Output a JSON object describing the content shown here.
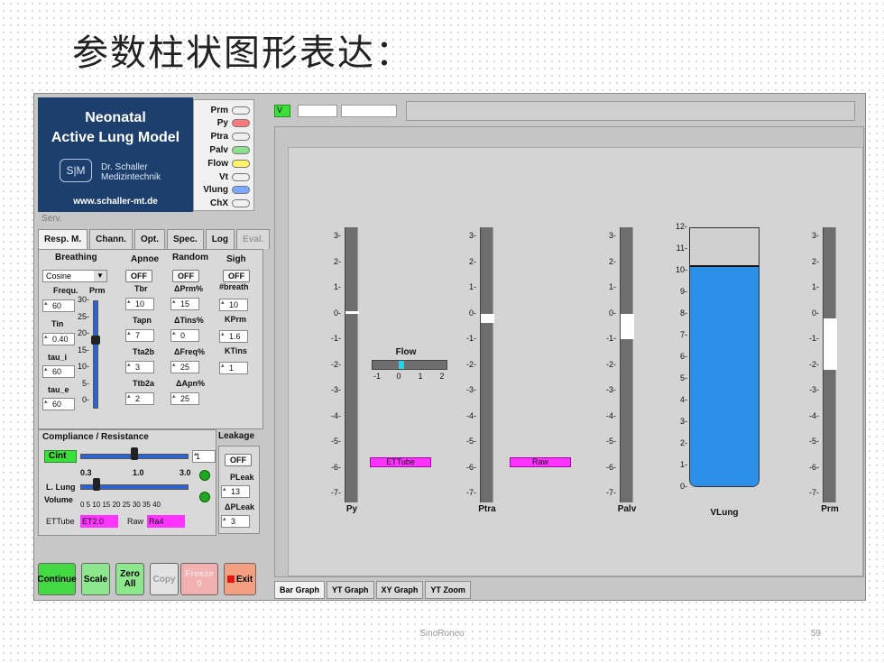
{
  "slide": {
    "title": "参数柱状图形表达：",
    "footer": "SinoRoneo",
    "page": "59"
  },
  "logo": {
    "title1": "Neonatal",
    "title2": "Active Lung Model",
    "emblem": "S|M",
    "company1": "Dr. Schaller",
    "company2": "Medizintechnik",
    "url": "www.schaller-mt.de"
  },
  "curves": [
    {
      "label": "Prm",
      "color": "#f0f0f0"
    },
    {
      "label": "Py",
      "color": "#ff7a7a"
    },
    {
      "label": "Ptra",
      "color": "#f0f0f0"
    },
    {
      "label": "Palv",
      "color": "#8de08d"
    },
    {
      "label": "Flow",
      "color": "#fff36a"
    },
    {
      "label": "Vt",
      "color": "#f0f0f0"
    },
    {
      "label": "Vlung",
      "color": "#7aa9ff"
    },
    {
      "label": "ChX",
      "color": "#f0f0f0"
    }
  ],
  "serv_label": "Serv.",
  "tabs": [
    "Resp. M.",
    "Chann.",
    "Opt.",
    "Spec.",
    "Log",
    "Eval."
  ],
  "breathing": {
    "headers": [
      "Breathing",
      "Apnoe",
      "Random",
      "Sigh"
    ],
    "waveform": "Cosine",
    "frequ_label": "Frequ.",
    "prm_label": "Prm",
    "frequ_value": "60",
    "tin_label": "Tin",
    "tin_value": "0.40",
    "taui_label": "tau_i",
    "taui_value": "60",
    "taue_label": "tau_e",
    "taue_value": "60",
    "prm_ticks": [
      "30-",
      "25-",
      "20-",
      "15-",
      "10-",
      "5-",
      "0-"
    ],
    "prm_value": 19,
    "apnoe_off": "OFF",
    "tbr_label": "Tbr",
    "tbr_value": "10",
    "tapn_label": "Tapn",
    "tapn_value": "7",
    "tta2b_label": "Tta2b",
    "tta2b_value": "3",
    "ttb2a_label": "Ttb2a",
    "ttb2a_value": "2",
    "random_off": "OFF",
    "dprm_label": "ΔPrm%",
    "dprm_value": "15",
    "dtins_label": "ΔTins%",
    "dtins_value": "0",
    "dfreq_label": "ΔFreq%",
    "dfreq_value": "25",
    "dapn_label": "ΔApn%",
    "dapn_value": "25",
    "sigh_off": "OFF",
    "nbreath_label": "#breath",
    "nbreath_value": "10",
    "kprm_label": "KPrm",
    "kprm_value": "1.6",
    "ktins_label": "KTins",
    "ktins_value": "1"
  },
  "compliance": {
    "header": "Compliance / Resistance",
    "leak_header": "Leakage",
    "cint_label": "Cint",
    "cint_value": "1",
    "cint_fraction": 0.5,
    "scale": [
      "0.3",
      "1.0",
      "3.0"
    ],
    "llung_label": "L. Lung",
    "volume_label": "Volume",
    "volume_ticks": "0  5  10 15 20 25 30 35 40",
    "volume_fraction": 0.15,
    "ettube_label": "ETTube",
    "ettube_value": "ET2.0",
    "raw_label": "Raw",
    "raw_value": "Ra4",
    "leak_off": "OFF",
    "pleak_label": "PLeak",
    "pleak_value": "13",
    "dpleak_label": "ΔPLeak",
    "dpleak_value": "3"
  },
  "buttons": {
    "continue": "Continue",
    "scale": "Scale",
    "zero1": "Zero",
    "zero2": "All",
    "copy": "Copy",
    "freeze": "Freeze 0",
    "exit": "Exit"
  },
  "top_strip": {
    "v_label": "V"
  },
  "gauges": [
    {
      "name": "Py",
      "ticks": [
        "3-",
        "2-",
        "1-",
        "0-",
        "-1-",
        "-2-",
        "-3-",
        "-4-",
        "-5-",
        "-6-",
        "-7-"
      ],
      "marker_value": 0.05,
      "marker_height": 0.1,
      "pink_label": ""
    },
    {
      "name": "Ptra",
      "ticks": [
        "3-",
        "2-",
        "1-",
        "0-",
        "-1-",
        "-2-",
        "-3-",
        "-4-",
        "-5-",
        "-6-",
        "-7-"
      ],
      "marker_value": -0.2,
      "marker_height": 0.35,
      "pink_label": "ETTube"
    },
    {
      "name": "Palv",
      "ticks": [
        "3-",
        "2-",
        "1-",
        "0-",
        "-1-",
        "-2-",
        "-3-",
        "-4-",
        "-5-",
        "-6-",
        "-7-"
      ],
      "marker_value": -0.5,
      "marker_height": 1.0,
      "pink_label": "Raw"
    },
    {
      "name": "Prm",
      "ticks": [
        "3-",
        "2-",
        "1-",
        "0-",
        "-1-",
        "-2-",
        "-3-",
        "-4-",
        "-5-",
        "-6-",
        "-7-"
      ],
      "marker_value": -1.2,
      "marker_height": 2.0,
      "pink_label": ""
    }
  ],
  "flow_gauge": {
    "label": "Flow",
    "ticks": [
      "-1",
      "0",
      "1",
      "2"
    ],
    "value": 0.0
  },
  "vlung": {
    "name": "VLung",
    "ticks": [
      "12-",
      "11-",
      "10-",
      "9-",
      "8-",
      "7-",
      "6-",
      "5-",
      "4-",
      "3-",
      "2-",
      "1-",
      "0-"
    ],
    "max": 12,
    "value": 10.2
  },
  "bottom_tabs": [
    "Bar Graph",
    "YT Graph",
    "XY Graph",
    "YT Zoom"
  ]
}
